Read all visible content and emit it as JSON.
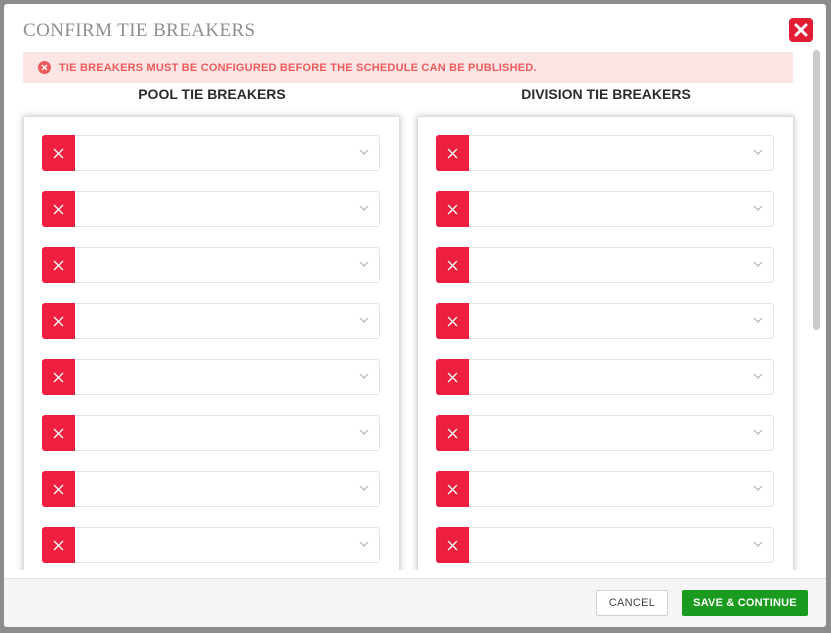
{
  "modal": {
    "title": "CONFIRM TIE BREAKERS"
  },
  "alert": {
    "text": "TIE BREAKERS MUST BE CONFIGURED BEFORE THE SCHEDULE CAN BE PUBLISHED."
  },
  "pool": {
    "heading": "POOL TIE BREAKERS",
    "selects": [
      "",
      "",
      "",
      "",
      "",
      "",
      "",
      ""
    ]
  },
  "division": {
    "heading": "DIVISION TIE BREAKERS",
    "selects": [
      "",
      "",
      "",
      "",
      "",
      "",
      "",
      ""
    ]
  },
  "footer": {
    "cancel_label": "CANCEL",
    "save_label": "SAVE & CONTINUE"
  },
  "colors": {
    "danger": "#ef1f3f",
    "success": "#1a9b1f",
    "alert_bg": "#fbe5e5",
    "alert_text": "#ef5b5b"
  },
  "icons": {
    "close": "close-icon",
    "alert": "alert-circle-x-icon",
    "remove": "x-icon",
    "dropdown": "chevron-down-icon"
  }
}
